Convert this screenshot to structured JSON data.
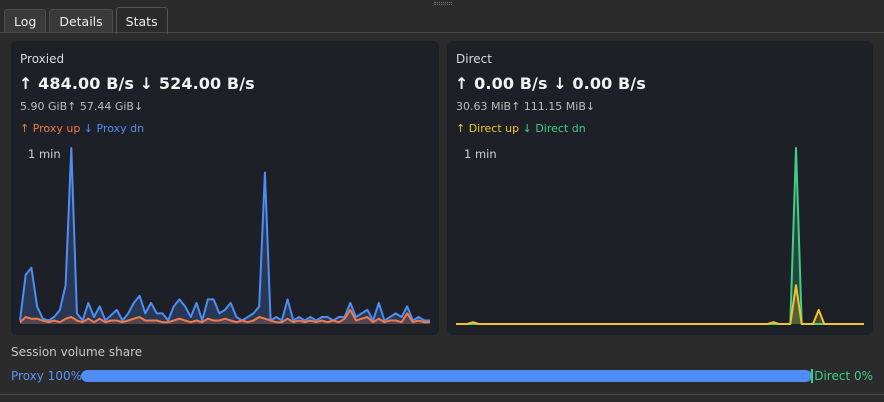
{
  "tabs": [
    {
      "label": "Log"
    },
    {
      "label": "Details"
    },
    {
      "label": "Stats",
      "active": true
    }
  ],
  "proxied": {
    "title": "Proxied",
    "rates": "↑ 484.00 B/s  ↓ 524.00 B/s",
    "totals": "5.90 GiB↑  57.44 GiB↓",
    "legend_up": "↑ Proxy up",
    "legend_down": "↓ Proxy dn",
    "window": "1 min",
    "colors": {
      "up": "#f07a4a",
      "down": "#4e8ef4"
    }
  },
  "direct": {
    "title": "Direct",
    "rates": "↑ 0.00 B/s  ↓ 0.00 B/s",
    "totals": "30.63 MiB↑  111.15 MiB↓",
    "legend_up": "↑ Direct up",
    "legend_down": "↓ Direct dn",
    "window": "1 min",
    "colors": {
      "up": "#f2c232",
      "down": "#3fcf86"
    }
  },
  "chart_data": [
    {
      "type": "area",
      "title": "Proxied",
      "x_window": "1 min",
      "series": [
        {
          "name": "Proxy dn",
          "color": "#4e8ef4",
          "values": [
            2,
            28,
            32,
            10,
            3,
            2,
            4,
            8,
            22,
            100,
            6,
            2,
            12,
            4,
            10,
            2,
            5,
            8,
            2,
            6,
            12,
            16,
            6,
            12,
            6,
            6,
            2,
            10,
            14,
            10,
            4,
            12,
            2,
            14,
            14,
            6,
            8,
            12,
            4,
            2,
            4,
            6,
            10,
            86,
            2,
            4,
            2,
            14,
            2,
            4,
            2,
            4,
            2,
            4,
            4,
            2,
            4,
            4,
            12,
            4,
            6,
            8,
            2,
            12,
            2,
            4,
            6,
            4,
            10,
            2,
            4,
            2,
            2
          ]
        },
        {
          "name": "Proxy up",
          "color": "#f07a4a",
          "values": [
            1,
            4,
            3,
            3,
            2,
            1,
            2,
            1,
            3,
            4,
            2,
            1,
            3,
            1,
            3,
            1,
            2,
            2,
            1,
            2,
            3,
            4,
            2,
            2,
            2,
            1,
            1,
            2,
            3,
            2,
            1,
            2,
            1,
            3,
            2,
            2,
            3,
            2,
            1,
            2,
            1,
            2,
            4,
            3,
            2,
            1,
            1,
            3,
            1,
            2,
            1,
            2,
            1,
            2,
            1,
            2,
            1,
            3,
            8,
            2,
            3,
            4,
            1,
            3,
            1,
            2,
            2,
            1,
            6,
            1,
            2,
            1,
            1
          ]
        }
      ]
    },
    {
      "type": "area",
      "title": "Direct",
      "x_window": "1 min",
      "series": [
        {
          "name": "Direct dn",
          "color": "#3fcf86",
          "values": [
            0,
            0,
            0,
            0,
            0,
            0,
            0,
            0,
            0,
            0,
            0,
            0,
            0,
            0,
            0,
            0,
            0,
            0,
            0,
            0,
            0,
            0,
            0,
            0,
            0,
            0,
            0,
            0,
            0,
            0,
            0,
            0,
            0,
            0,
            0,
            0,
            0,
            0,
            0,
            0,
            0,
            0,
            0,
            0,
            0,
            0,
            0,
            0,
            0,
            0,
            0,
            0,
            0,
            0,
            0,
            0,
            0,
            0,
            0,
            0,
            100,
            0,
            0,
            0,
            0,
            0,
            0,
            0,
            0,
            0,
            0,
            0,
            0
          ]
        },
        {
          "name": "Direct up",
          "color": "#f2c232",
          "values": [
            0,
            0,
            0,
            1,
            0,
            0,
            0,
            0,
            0,
            0,
            0,
            0,
            0,
            0,
            0,
            0,
            0,
            0,
            0,
            0,
            0,
            0,
            0,
            0,
            0,
            0,
            0,
            0,
            0,
            0,
            0,
            0,
            0,
            0,
            0,
            0,
            0,
            0,
            0,
            0,
            0,
            0,
            0,
            0,
            0,
            0,
            0,
            0,
            0,
            0,
            0,
            0,
            0,
            0,
            0,
            0,
            1,
            0,
            0,
            0,
            22,
            0,
            0,
            0,
            8,
            0,
            0,
            0,
            0,
            0,
            0,
            0,
            0
          ]
        }
      ]
    }
  ],
  "share": {
    "title": "Session volume share",
    "left_label": "Proxy 100%",
    "right_label": "Direct 0%",
    "proxy_fraction": 1.0
  }
}
